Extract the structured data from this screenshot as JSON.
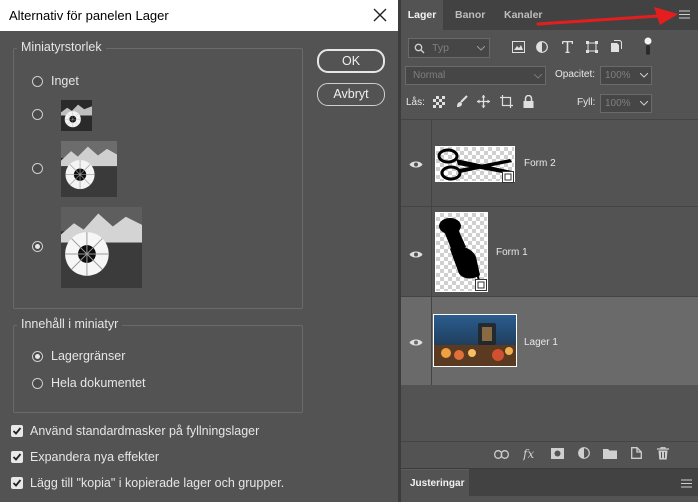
{
  "dialog": {
    "title": "Alternativ för panelen Lager",
    "size_group": {
      "legend": "Miniatyrstorlek",
      "options": [
        {
          "label": "Inget",
          "selected": false
        },
        {
          "label": "",
          "selected": false
        },
        {
          "label": "",
          "selected": false
        },
        {
          "label": "",
          "selected": true
        }
      ]
    },
    "content_group": {
      "legend": "Innehåll i miniatyr",
      "options": [
        {
          "label": "Lagergränser",
          "selected": true
        },
        {
          "label": "Hela dokumentet",
          "selected": false
        }
      ]
    },
    "checkboxes": [
      {
        "label": "Använd standardmasker på fyllningslager",
        "checked": true
      },
      {
        "label": "Expandera nya effekter",
        "checked": true
      },
      {
        "label": "Lägg till \"kopia\" i kopierade lager och grupper.",
        "checked": true
      }
    ],
    "buttons": {
      "ok": "OK",
      "cancel": "Avbryt"
    }
  },
  "layers_panel": {
    "tabs": [
      {
        "label": "Lager",
        "active": true
      },
      {
        "label": "Banor",
        "active": false
      },
      {
        "label": "Kanaler",
        "active": false
      }
    ],
    "filter": {
      "placeholder": "Typ",
      "icons": [
        "image-filter-icon",
        "adjustment-filter-icon",
        "type-filter-icon",
        "shape-filter-icon",
        "smart-object-filter-icon"
      ]
    },
    "blend_mode": "Normal",
    "opacity": {
      "label": "Opacitet:",
      "value": "100%"
    },
    "lock": {
      "label": "Lås:"
    },
    "fill": {
      "label": "Fyll:",
      "value": "100%"
    },
    "layers": [
      {
        "name": "Form 2",
        "visible": true,
        "selected": false
      },
      {
        "name": "Form 1",
        "visible": true,
        "selected": false
      },
      {
        "name": "Lager 1",
        "visible": true,
        "selected": true
      }
    ]
  },
  "adjustments_panel": {
    "title": "Justeringar"
  },
  "annotation": {
    "arrow_color": "#e41e1e"
  }
}
